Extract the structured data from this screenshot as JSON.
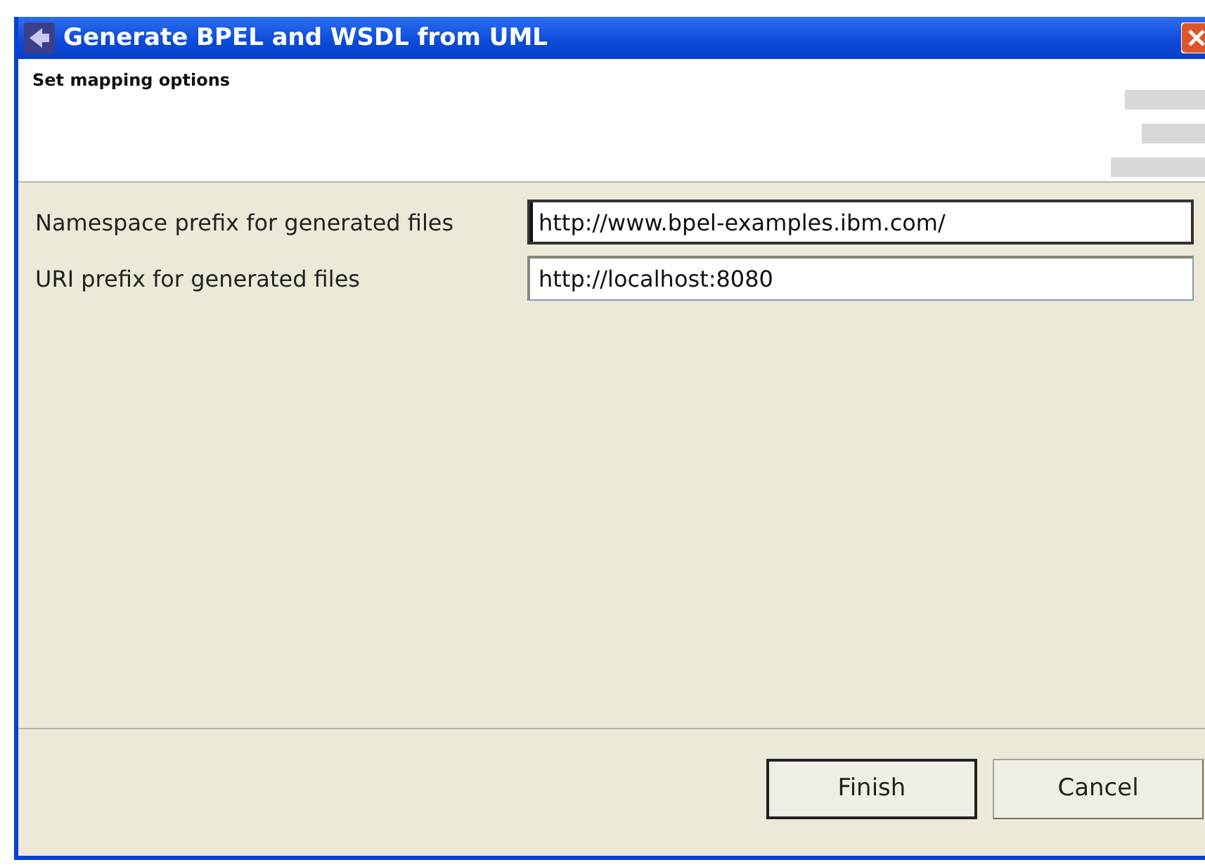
{
  "window": {
    "title": "Generate BPEL and WSDL from UML"
  },
  "header": {
    "title": "Set mapping options"
  },
  "fields": [
    {
      "label": "Namespace prefix for generated files",
      "value": "http://www.bpel-examples.ibm.com/",
      "focused": true
    },
    {
      "label": "URI prefix for generated files",
      "value": "http://localhost:8080",
      "focused": false
    }
  ],
  "buttons": [
    {
      "label": "Finish",
      "default": true
    },
    {
      "label": "Cancel",
      "default": false
    }
  ]
}
